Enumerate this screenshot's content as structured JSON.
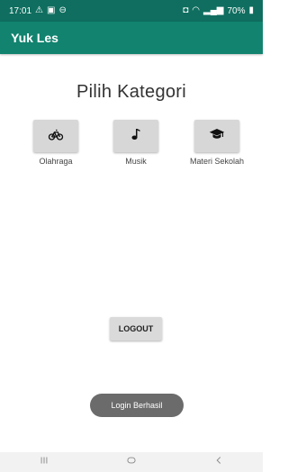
{
  "status_bar": {
    "time": "17:01",
    "battery": "70%"
  },
  "app_bar": {
    "title": "Yuk Les"
  },
  "main": {
    "heading": "Pilih Kategori",
    "categories": [
      {
        "label": "Olahraga",
        "icon": "bicycle-icon"
      },
      {
        "label": "Musik",
        "icon": "music-note-icon"
      },
      {
        "label": "Materi Sekolah",
        "icon": "graduation-cap-icon"
      }
    ],
    "logout_label": "LOGOUT"
  },
  "toast": {
    "message": "Login Berhasil"
  },
  "colors": {
    "status_bar": "#0f6e5f",
    "app_bar": "#12836f",
    "button": "#d7d7d7",
    "toast": "#6b6b6b"
  }
}
